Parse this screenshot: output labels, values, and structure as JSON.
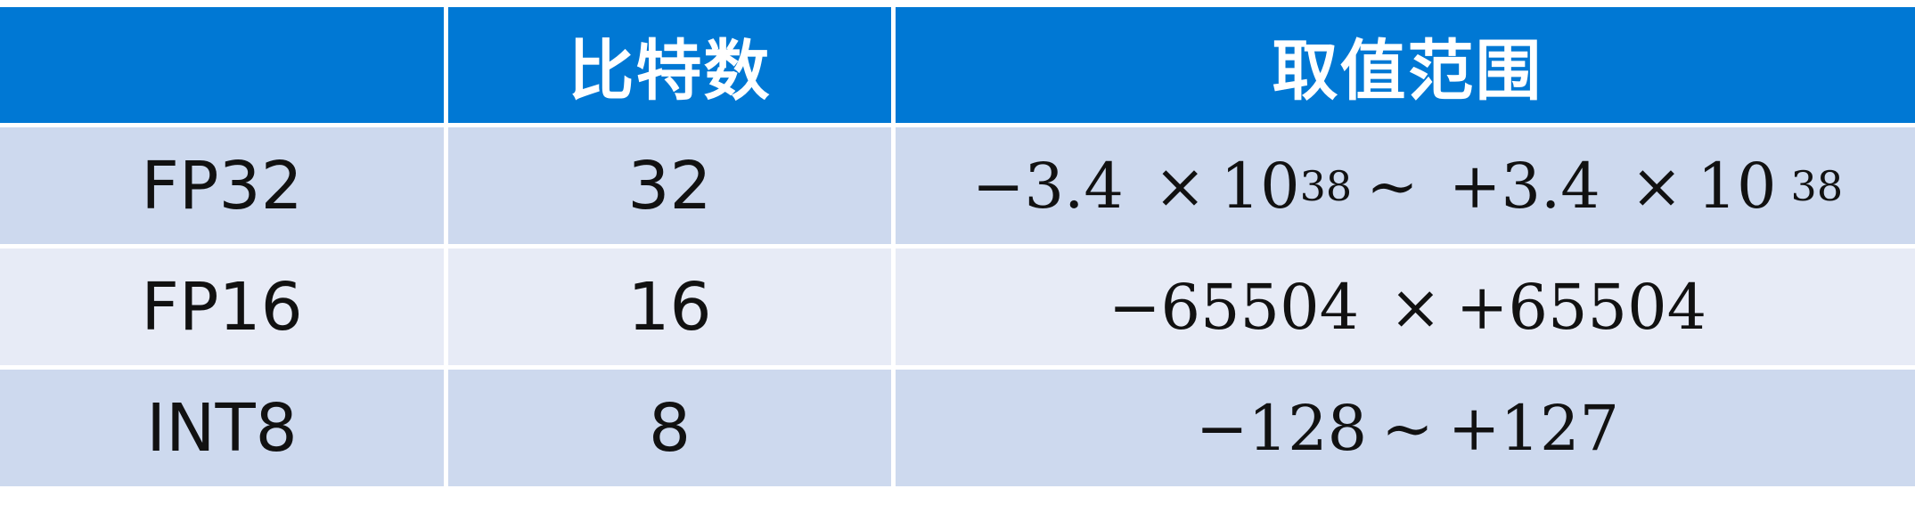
{
  "table": {
    "headers": [
      "",
      "比特数",
      "取值范围"
    ],
    "rows": [
      {
        "type": "FP32",
        "bits": "32",
        "range": {
          "lo_mantissa": "−3.4",
          "times": "×",
          "base": "10",
          "exp": "38",
          "tilde": "~",
          "hi_mantissa": "+3.4",
          "times2": "×",
          "base2": "10",
          "exp2": "38"
        }
      },
      {
        "type": "FP16",
        "bits": "16",
        "range": {
          "lo": "−65504",
          "sep": "×",
          "hi": "+65504"
        }
      },
      {
        "type": "INT8",
        "bits": "8",
        "range": {
          "lo": "−128",
          "sep": "~",
          "hi": "+127"
        }
      }
    ]
  }
}
